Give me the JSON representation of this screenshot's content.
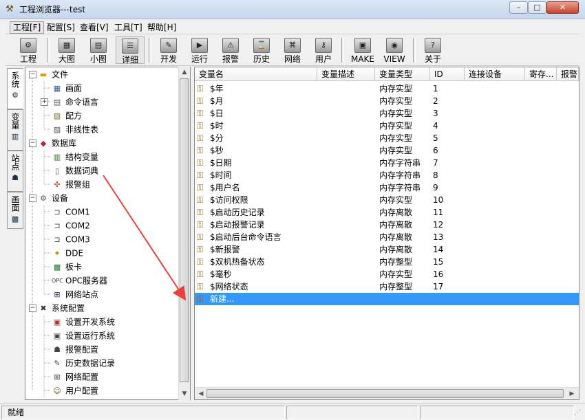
{
  "window": {
    "title": "工程浏览器---test",
    "min": "–",
    "max": "□",
    "close": "✕"
  },
  "menu": [
    "工程[F]",
    "配置[S]",
    "查看[V]",
    "工具[T]",
    "帮助[H]"
  ],
  "toolbar": {
    "project": "工程",
    "large": "大图",
    "small": "小图",
    "detail": "详细",
    "develop": "开发",
    "run": "运行",
    "alarm": "报警",
    "history": "历史",
    "network": "网络",
    "user": "用户",
    "make": "MAKE",
    "view": "VIEW",
    "about": "关于"
  },
  "side_tabs": [
    "系统",
    "变量",
    "站点",
    "画面"
  ],
  "tree": [
    {
      "label": "文件",
      "icon": "folder-icon"
    },
    {
      "label": "画面",
      "icon": "screen-icon"
    },
    {
      "label": "命令语言",
      "icon": "document-icon"
    },
    {
      "label": "配方",
      "icon": "recipe-icon"
    },
    {
      "label": "非线性表",
      "icon": "table-icon"
    },
    {
      "label": "数据库",
      "icon": "database-icon"
    },
    {
      "label": "结构变量",
      "icon": "struct-icon"
    },
    {
      "label": "数据词典",
      "icon": "dictionary-icon"
    },
    {
      "label": "报警组",
      "icon": "alarm-group-icon"
    },
    {
      "label": "设备",
      "icon": "device-icon"
    },
    {
      "label": "COM1",
      "icon": "port-icon"
    },
    {
      "label": "COM2",
      "icon": "port-icon"
    },
    {
      "label": "COM3",
      "icon": "port-icon"
    },
    {
      "label": "DDE",
      "icon": "dde-icon"
    },
    {
      "label": "板卡",
      "icon": "board-icon"
    },
    {
      "label": "OPC服务器",
      "icon": "opc-icon"
    },
    {
      "label": "网络站点",
      "icon": "network-station-icon"
    },
    {
      "label": "系统配置",
      "icon": "tools-icon"
    },
    {
      "label": "设置开发系统",
      "icon": "dev-setting-icon"
    },
    {
      "label": "设置运行系统",
      "icon": "run-setting-icon"
    },
    {
      "label": "报警配置",
      "icon": "alarm-config-icon"
    },
    {
      "label": "历史数据记录",
      "icon": "history-record-icon"
    },
    {
      "label": "网络配置",
      "icon": "network-config-icon"
    },
    {
      "label": "用户配置",
      "icon": "user-config-icon"
    }
  ],
  "columns": [
    "变量名",
    "变量描述",
    "变量类型",
    "ID",
    "连接设备",
    "寄存...",
    "报警"
  ],
  "rows": [
    {
      "name": "$年",
      "type": "内存实型",
      "id": "1"
    },
    {
      "name": "$月",
      "type": "内存实型",
      "id": "2"
    },
    {
      "name": "$日",
      "type": "内存实型",
      "id": "3"
    },
    {
      "name": "$时",
      "type": "内存实型",
      "id": "4"
    },
    {
      "name": "$分",
      "type": "内存实型",
      "id": "5"
    },
    {
      "name": "$秒",
      "type": "内存实型",
      "id": "6"
    },
    {
      "name": "$日期",
      "type": "内存字符串",
      "id": "7"
    },
    {
      "name": "$时间",
      "type": "内存字符串",
      "id": "8"
    },
    {
      "name": "$用户名",
      "type": "内存字符串",
      "id": "9"
    },
    {
      "name": "$访问权限",
      "type": "内存实型",
      "id": "10"
    },
    {
      "name": "$启动历史记录",
      "type": "内存离散",
      "id": "11"
    },
    {
      "name": "$启动报警记录",
      "type": "内存离散",
      "id": "12"
    },
    {
      "name": "$启动后台命令语言",
      "type": "内存离散",
      "id": "13"
    },
    {
      "name": "$新报警",
      "type": "内存离散",
      "id": "14"
    },
    {
      "name": "$双机热备状态",
      "type": "内存整型",
      "id": "15"
    },
    {
      "name": "$毫秒",
      "type": "内存实型",
      "id": "16"
    },
    {
      "name": "$网络状态",
      "type": "内存整型",
      "id": "17"
    },
    {
      "name": "新建...",
      "type": "",
      "id": ""
    }
  ],
  "status": {
    "text": "就绪"
  },
  "colors": {
    "selection": "#3399ff",
    "arrow": "#e8413a"
  }
}
